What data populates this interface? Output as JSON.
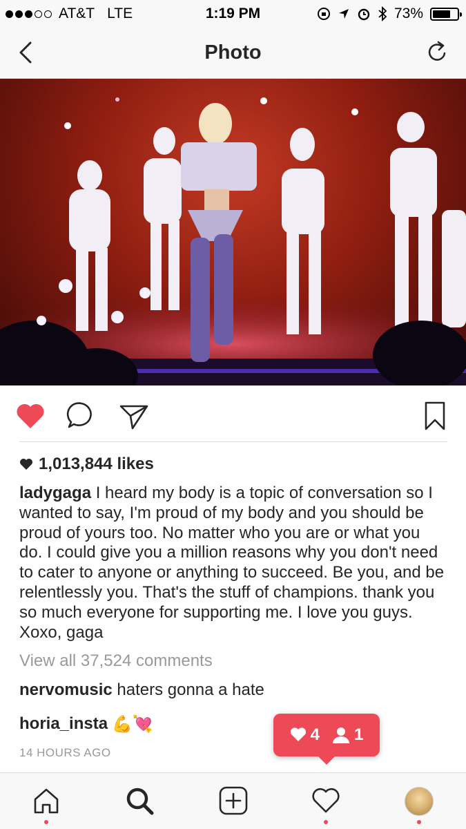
{
  "status_bar": {
    "carrier": "AT&T",
    "network": "LTE",
    "time": "1:19 PM",
    "battery": "73%",
    "battery_level": 0.73
  },
  "header": {
    "title": "Photo"
  },
  "post": {
    "likes": "1,013,844 likes",
    "caption_user": "ladygaga",
    "caption_text": " I heard my body is a topic of conversation so I wanted to say, I'm proud of my body and you should be proud of yours too. No matter who you are or what you do. I could give you a million reasons why you don't need to cater to anyone or anything to succeed. Be you, and be relentlessly you. That's the stuff of champions. thank you so much everyone for supporting me. I love you guys. Xoxo, gaga",
    "view_all": "View all 37,524 comments",
    "comments": [
      {
        "user": "nervomusic",
        "text": " haters gonna a hate"
      },
      {
        "user": "horia_insta",
        "text": "💪💘"
      }
    ],
    "time_ago": "14 HOURS AGO"
  },
  "notification": {
    "likes": "4",
    "follows": "1"
  },
  "colors": {
    "accent_red": "#ed4956",
    "muted_text": "#999999"
  },
  "icons": {
    "back": "chevron-left-icon",
    "refresh": "refresh-icon",
    "like": "heart-icon",
    "comment": "comment-icon",
    "share": "send-icon",
    "save": "bookmark-icon",
    "home": "home-icon",
    "search": "search-icon",
    "add": "add-icon",
    "activity": "heart-icon",
    "profile": "avatar"
  }
}
